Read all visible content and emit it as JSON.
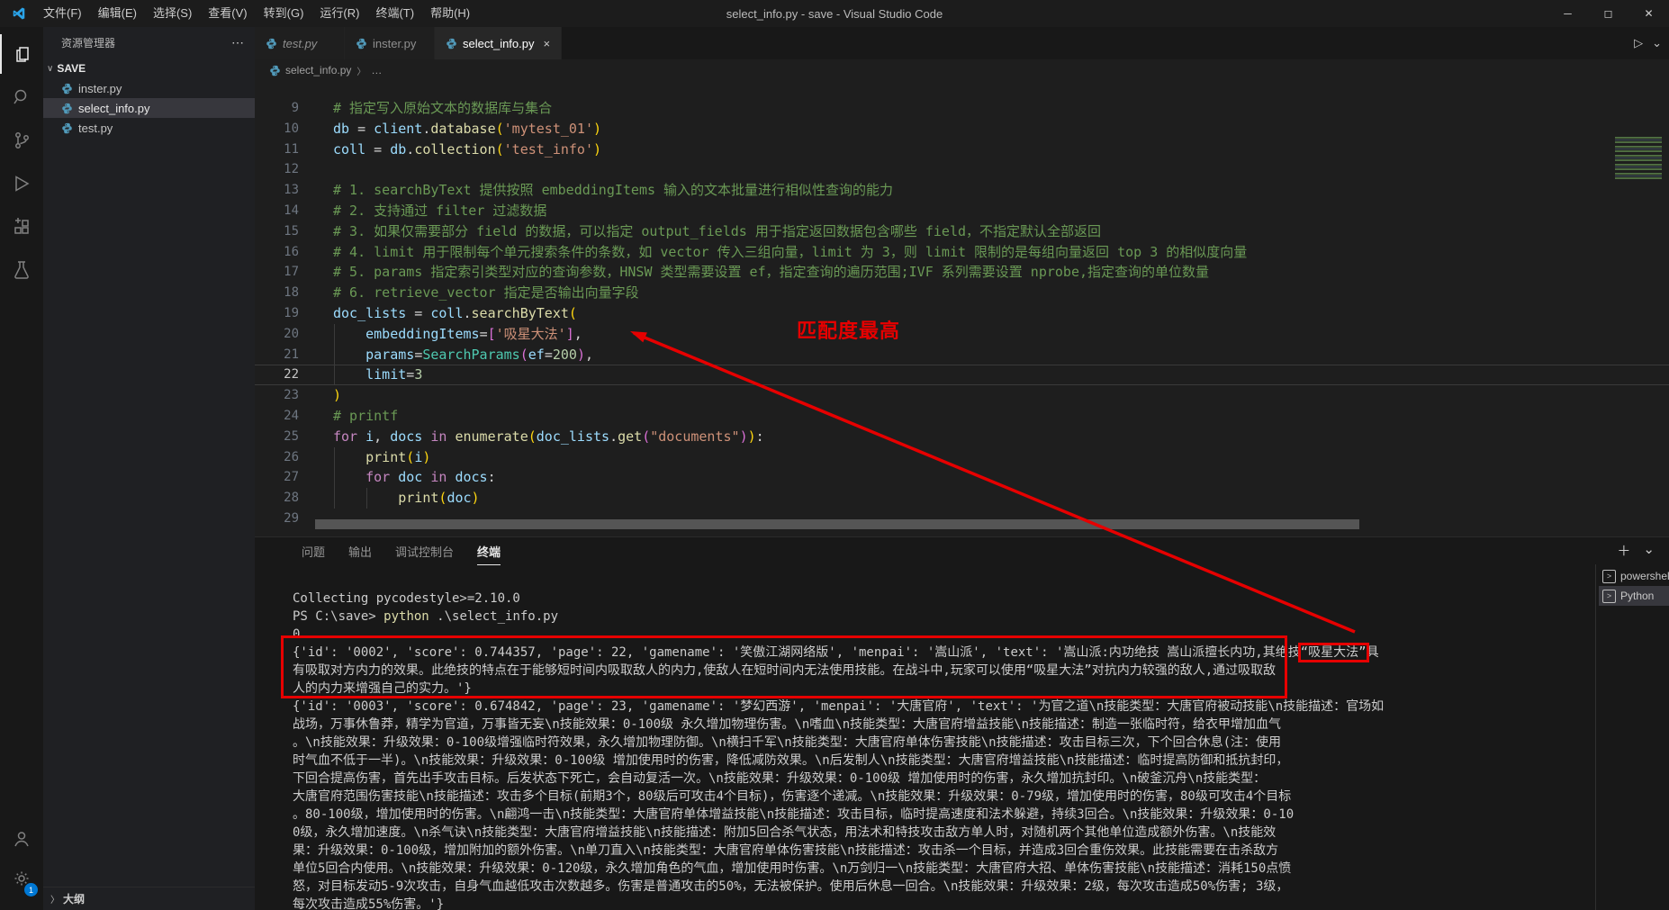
{
  "window": {
    "title": "select_info.py - save - Visual Studio Code",
    "menus": [
      "文件(F)",
      "编辑(E)",
      "选择(S)",
      "查看(V)",
      "转到(G)",
      "运行(R)",
      "终端(T)",
      "帮助(H)"
    ],
    "controls": {
      "minimize": "─",
      "maximize": "◻",
      "close": "✕"
    }
  },
  "icons": {
    "run": "▷",
    "chevron_down": "⌄",
    "more": "⋯",
    "plus": "＋",
    "chevron_expand": "∨",
    "chevron_right": "〉",
    "terminal_prompt": ">",
    "breadcrumb_more": "…"
  },
  "sidebar": {
    "title": "资源管理器",
    "section": "SAVE",
    "files": [
      {
        "name": "inster.py",
        "selected": false
      },
      {
        "name": "select_info.py",
        "selected": true
      },
      {
        "name": "test.py",
        "selected": false
      }
    ],
    "outline_label": "大纲"
  },
  "tabs": [
    {
      "label": "test.py",
      "preview": true,
      "active": false
    },
    {
      "label": "inster.py",
      "preview": false,
      "active": false
    },
    {
      "label": "select_info.py",
      "preview": false,
      "active": true,
      "close": "×"
    }
  ],
  "breadcrumb": {
    "file": "select_info.py"
  },
  "editor": {
    "lines": [
      {
        "n": 9,
        "t": [
          [
            "c",
            "# 指定写入原始文本的数据库与集合"
          ]
        ]
      },
      {
        "n": 10,
        "t": [
          [
            "v",
            "db"
          ],
          [
            "w",
            " = "
          ],
          [
            "v",
            "client"
          ],
          [
            "w",
            "."
          ],
          [
            "f",
            "database"
          ],
          [
            "b1",
            "("
          ],
          [
            "s",
            "'mytest_01'"
          ],
          [
            "b1",
            ")"
          ]
        ]
      },
      {
        "n": 11,
        "t": [
          [
            "v",
            "coll"
          ],
          [
            "w",
            " = "
          ],
          [
            "v",
            "db"
          ],
          [
            "w",
            "."
          ],
          [
            "f",
            "collection"
          ],
          [
            "b1",
            "("
          ],
          [
            "s",
            "'test_info'"
          ],
          [
            "b1",
            ")"
          ]
        ]
      },
      {
        "n": 12,
        "t": []
      },
      {
        "n": 13,
        "t": [
          [
            "c",
            "# 1. searchByText 提供按照 embeddingItems 输入的文本批量进行相似性查询的能力"
          ]
        ]
      },
      {
        "n": 14,
        "t": [
          [
            "c",
            "# 2. 支持通过 filter 过滤数据"
          ]
        ]
      },
      {
        "n": 15,
        "t": [
          [
            "c",
            "# 3. 如果仅需要部分 field 的数据，可以指定 output_fields 用于指定返回数据包含哪些 field，不指定默认全部返回"
          ]
        ]
      },
      {
        "n": 16,
        "t": [
          [
            "c",
            "# 4. limit 用于限制每个单元搜索条件的条数，如 vector 传入三组向量，limit 为 3，则 limit 限制的是每组向量返回 top 3 的相似度向量"
          ]
        ]
      },
      {
        "n": 17,
        "t": [
          [
            "c",
            "# 5. params 指定索引类型对应的查询参数，HNSW 类型需要设置 ef，指定查询的遍历范围;IVF 系列需要设置 nprobe,指定查询的单位数量"
          ]
        ]
      },
      {
        "n": 18,
        "t": [
          [
            "c",
            "# 6. retrieve_vector 指定是否输出向量字段"
          ]
        ]
      },
      {
        "n": 19,
        "t": [
          [
            "v",
            "doc_lists"
          ],
          [
            "w",
            " = "
          ],
          [
            "v",
            "coll"
          ],
          [
            "w",
            "."
          ],
          [
            "f",
            "searchByText"
          ],
          [
            "b1",
            "("
          ]
        ]
      },
      {
        "n": 20,
        "t": [
          [
            "w",
            "    "
          ],
          [
            "v",
            "embeddingItems"
          ],
          [
            "w",
            "="
          ],
          [
            "b2",
            "["
          ],
          [
            "s",
            "'吸星大法'"
          ],
          [
            "b2",
            "]"
          ],
          [
            "w",
            ","
          ]
        ]
      },
      {
        "n": 21,
        "t": [
          [
            "w",
            "    "
          ],
          [
            "v",
            "params"
          ],
          [
            "w",
            "="
          ],
          [
            "t",
            "SearchParams"
          ],
          [
            "b2",
            "("
          ],
          [
            "v",
            "ef"
          ],
          [
            "w",
            "="
          ],
          [
            "n",
            "200"
          ],
          [
            "b2",
            ")"
          ],
          [
            "w",
            ","
          ]
        ]
      },
      {
        "n": 22,
        "current": true,
        "t": [
          [
            "w",
            "    "
          ],
          [
            "v",
            "limit"
          ],
          [
            "w",
            "="
          ],
          [
            "n",
            "3"
          ]
        ]
      },
      {
        "n": 23,
        "t": [
          [
            "b1",
            ")"
          ]
        ]
      },
      {
        "n": 24,
        "t": [
          [
            "c",
            "# printf"
          ]
        ]
      },
      {
        "n": 25,
        "t": [
          [
            "k",
            "for"
          ],
          [
            "w",
            " "
          ],
          [
            "v",
            "i"
          ],
          [
            "w",
            ", "
          ],
          [
            "v",
            "docs"
          ],
          [
            "w",
            " "
          ],
          [
            "k",
            "in"
          ],
          [
            "w",
            " "
          ],
          [
            "f",
            "enumerate"
          ],
          [
            "b1",
            "("
          ],
          [
            "v",
            "doc_lists"
          ],
          [
            "w",
            "."
          ],
          [
            "f",
            "get"
          ],
          [
            "b2",
            "("
          ],
          [
            "s",
            "\"documents\""
          ],
          [
            "b2",
            ")"
          ],
          [
            "b1",
            ")"
          ],
          [
            "w",
            ":"
          ]
        ]
      },
      {
        "n": 26,
        "t": [
          [
            "w",
            "    "
          ],
          [
            "f",
            "print"
          ],
          [
            "b1",
            "("
          ],
          [
            "v",
            "i"
          ],
          [
            "b1",
            ")"
          ]
        ]
      },
      {
        "n": 27,
        "t": [
          [
            "w",
            "    "
          ],
          [
            "k",
            "for"
          ],
          [
            "w",
            " "
          ],
          [
            "v",
            "doc"
          ],
          [
            "w",
            " "
          ],
          [
            "k",
            "in"
          ],
          [
            "w",
            " "
          ],
          [
            "v",
            "docs"
          ],
          [
            "w",
            ":"
          ]
        ]
      },
      {
        "n": 28,
        "t": [
          [
            "w",
            "        "
          ],
          [
            "f",
            "print"
          ],
          [
            "b1",
            "("
          ],
          [
            "v",
            "doc"
          ],
          [
            "b1",
            ")"
          ]
        ]
      },
      {
        "n": 29,
        "t": []
      }
    ]
  },
  "annotations": {
    "match_label": "匹配度最高",
    "accent_red": "#e60000"
  },
  "panel": {
    "tabs": [
      {
        "label": "问题",
        "active": false
      },
      {
        "label": "输出",
        "active": false
      },
      {
        "label": "调试控制台",
        "active": false
      },
      {
        "label": "终端",
        "active": true
      }
    ],
    "terminal_list": [
      {
        "label": "powershell",
        "active": false
      },
      {
        "label": "Python",
        "active": true
      }
    ],
    "terminal_lines": [
      {
        "t": [
          [
            "p",
            "Collecting pycodestyle>=2.10.0"
          ]
        ]
      },
      {
        "t": [
          [
            "p",
            "PS C:\\save> "
          ],
          [
            "y",
            "python"
          ],
          [
            "p",
            " .\\select_info.py"
          ]
        ]
      },
      {
        "t": [
          [
            "p",
            "0"
          ]
        ]
      },
      {
        "t": [
          [
            "p",
            "{'id': '0002', 'score': 0.744357, 'page': 22, 'gamename': '笑傲江湖网络版', 'menpai': '嵩山派', 'text': '嵩山派:内功绝技 嵩山派擅长内功,其绝技"
          ],
          [
            "hl",
            "“吸星大法”"
          ],
          [
            "p",
            "具"
          ]
        ]
      },
      {
        "t": [
          [
            "p",
            "有吸取对方内力的效果。此绝技的特点在于能够短时间内吸取敌人的内力,使敌人在短时间内无法使用技能。在战斗中,玩家可以使用“吸星大法”对抗内力较强的敌人,通过吸取敌"
          ]
        ]
      },
      {
        "t": [
          [
            "p",
            "人的内力来增强自己的实力。'}"
          ]
        ]
      },
      {
        "t": [
          [
            "p",
            "{'id': '0003', 'score': 0.674842, 'page': 23, 'gamename': '梦幻西游', 'menpai': '大唐官府', 'text': '为官之道\\n技能类型：大唐官府被动技能\\n技能描述：官场如"
          ]
        ]
      },
      {
        "t": [
          [
            "p",
            "战场，万事休鲁莽，精学为官道，万事皆无妄\\n技能效果：0-100级 永久增加物理伤害。\\n嗜血\\n技能类型：大唐官府增益技能\\n技能描述：制造一张临时符，给衣甲增加血气"
          ]
        ]
      },
      {
        "t": [
          [
            "p",
            "。\\n技能效果：升级效果：0-100级增强临时符效果，永久增加物理防御。\\n横扫千军\\n技能类型：大唐官府单体伤害技能\\n技能描述：攻击目标三次，下个回合休息(注：使用"
          ]
        ]
      },
      {
        "t": [
          [
            "p",
            "时气血不低于一半)。\\n技能效果：升级效果：0-100级 增加使用时的伤害，降低减防效果。\\n后发制人\\n技能类型：大唐官府增益技能\\n技能描述：临时提高防御和抵抗封印，"
          ]
        ]
      },
      {
        "t": [
          [
            "p",
            "下回合提高伤害，首先出手攻击目标。后发状态下死亡，会自动复活一次。\\n技能效果：升级效果：0-100级 增加使用时的伤害，永久增加抗封印。\\n破釜沉舟\\n技能类型："
          ]
        ]
      },
      {
        "t": [
          [
            "p",
            "大唐官府范围伤害技能\\n技能描述：攻击多个目标(前期3个，80级后可攻击4个目标)，伤害逐个递减。\\n技能效果：升级效果：0-79级，增加使用时的伤害，80级可攻击4个目标"
          ]
        ]
      },
      {
        "t": [
          [
            "p",
            "。80-100级，增加使用时的伤害。\\n翩鸿一击\\n技能类型：大唐官府单体增益技能\\n技能描述：攻击目标，临时提高速度和法术躲避，持续3回合。\\n技能效果：升级效果：0-10"
          ]
        ]
      },
      {
        "t": [
          [
            "p",
            "0级，永久增加速度。\\n杀气诀\\n技能类型：大唐官府增益技能\\n技能描述：附加5回合杀气状态，用法术和特技攻击敌方单人时，对随机两个其他单位造成额外伤害。\\n技能效"
          ]
        ]
      },
      {
        "t": [
          [
            "p",
            "果：升级效果：0-100级，增加附加的额外伤害。\\n单刀直入\\n技能类型：大唐官府单体伤害技能\\n技能描述：攻击杀一个目标，并造成3回合重伤效果。此技能需要在击杀敌方"
          ]
        ]
      },
      {
        "t": [
          [
            "p",
            "单位5回合内使用。\\n技能效果：升级效果：0-120级，永久增加角色的气血，增加使用时伤害。\\n万剑归一\\n技能类型：大唐官府大招、单体伤害技能\\n技能描述：消耗150点愤"
          ]
        ]
      },
      {
        "t": [
          [
            "p",
            "怒，对目标发动5-9次攻击，自身气血越低攻击次数越多。伤害是普通攻击的50%，无法被保护。使用后休息一回合。\\n技能效果：升级效果：2级，每次攻击造成50%伤害; 3级，"
          ]
        ]
      },
      {
        "t": [
          [
            "p",
            "每次攻击造成55%伤害。'}"
          ]
        ]
      }
    ]
  }
}
